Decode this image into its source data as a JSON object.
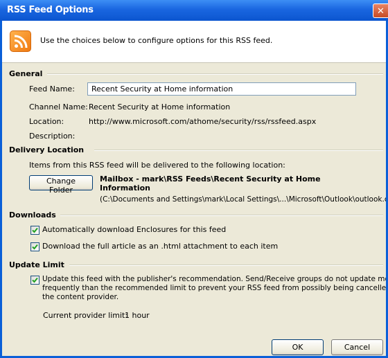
{
  "window": {
    "title": "RSS Feed Options",
    "close_glyph": "✕"
  },
  "header": {
    "icon": "rss-feed-icon",
    "text": "Use the choices below to configure options for this RSS feed."
  },
  "general": {
    "title": "General",
    "feed_name_label": "Feed Name:",
    "feed_name_value": "Recent Security at Home information",
    "channel_name_label": "Channel Name:",
    "channel_name_value": "Recent Security at Home information",
    "location_label": "Location:",
    "location_value": "http://www.microsoft.com/athome/security/rss/rssfeed.aspx",
    "description_label": "Description:"
  },
  "delivery": {
    "title": "Delivery Location",
    "intro": "Items from this RSS feed will be delivered to the following location:",
    "change_folder_label": "Change Folder",
    "path_line1": "Mailbox - mark\\RSS Feeds\\Recent Security at Home",
    "path_line2": "Information",
    "path_file": "(C:\\Documents and Settings\\mark\\Local Settings\\...\\Microsoft\\Outlook\\outlook.ost)"
  },
  "downloads": {
    "title": "Downloads",
    "enclosures_label": "Automatically download Enclosures for this feed",
    "enclosures_checked": true,
    "full_article_label": "Download the full article as an .html attachment to each item",
    "full_article_checked": true
  },
  "update_limit": {
    "title": "Update Limit",
    "line1": "Update this feed with the publisher's recommendation. Send/Receive groups do not update more",
    "line2": "frequently than the recommended limit to prevent your RSS feed from possibly being cancelled by",
    "line3": "the content provider.",
    "checked": true,
    "provider_limit_label": "Current provider limit:",
    "provider_limit_value": "1 hour"
  },
  "buttons": {
    "ok_label": "OK",
    "cancel_label": "Cancel"
  },
  "colors": {
    "title_bar": "#0a5fd8",
    "dialog_background": "#ece9d8",
    "close_button": "#d9612f",
    "rss_icon": "#f58a1f"
  }
}
